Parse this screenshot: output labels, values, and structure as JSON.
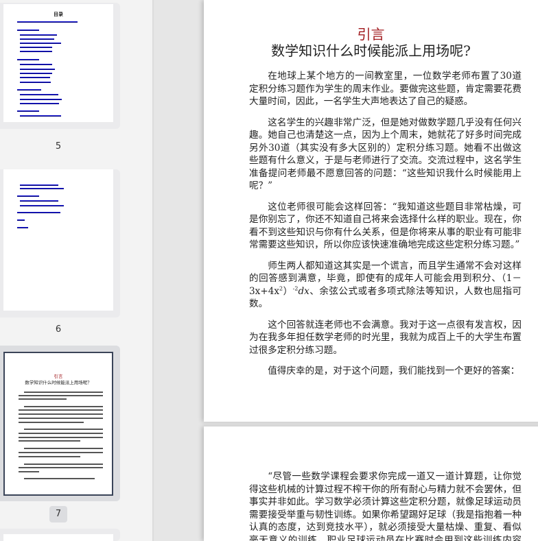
{
  "sidebar": {
    "thumbnails": [
      {
        "page_label": "5",
        "title": "目录"
      },
      {
        "page_label": "6"
      },
      {
        "page_label": "7",
        "title": "引言",
        "subtitle": "数学知识什么时候能派上用场呢？",
        "selected": true
      }
    ]
  },
  "document": {
    "page1": {
      "title": "引言",
      "subtitle": "数学知识什么时候能派上用场呢?",
      "paragraphs": [
        "在地球上某个地方的一间教室里，一位数学老师布置了30道定积分练习题作为学生的周末作业。要做完这些题，肯定需要花费大量时间，因此，一名学生大声地表达了自己的疑惑。",
        "这名学生的兴趣非常广泛，但是她对做数学题几乎没有任何兴趣。她自己也清楚这一点，因为上个周末，她就花了好多时间完成另外30道（其实没有多大区别的）定积分练习题。她看不出做这些题有什么意义，于是与老师进行了交流。交流过程中，这名学生准备提问老师最不愿意回答的问题：“这些知识我什么时候能用上呢？”",
        "这位老师很可能会这样回答：“我知道这些题目非常枯燥，可是你别忘了，你还不知道自己将来会选择什么样的职业。现在，你看不到这些知识与你有什么关系，但是你将来从事的职业有可能非常需要这些知识，所以你应该快速准确地完成这些定积分练习题。”",
        "这个回答就连老师也不会满意。我对于这一点很有发言权，因为在我多年担任数学老师的时光里，我就为成百上千的大学生布置过很多定积分练习题。",
        "值得庆幸的是，对于这个问题，我们能找到一个更好的答案："
      ],
      "para4_before": "师生两人都知道这其实是一个谎言，而且学生通常不会对这样的回答感到满意，毕竟，即使有的成年人可能会用到积分、（1－3x+4x",
      "para4_exp1": "2",
      "para4_mid": "）",
      "para4_exp2": "-2",
      "para4_dx": "dx",
      "para4_after": "、余弦公式或者多项式除法等知识，人数也屈指可数。"
    },
    "page2": {
      "paragraphs": [
        "“尽管一些数学课程会要求你完成一道又一道计算题，让你觉得这些机械的计算过程不榨干你的所有耐心与精力就不会罢休，但事实并非如此。学习数学必须计算这些定积分题，就像足球运动员需要接受举重与韧性训练。如果你希望踢好足球（我是指抱着一种认真的态度，达到竞技水平），就必须接受大量枯燥、重复、看似毫无意义的训练。职业足球运动员在比赛时会用到这些训练内容吗？不会的，我们从未在赛场"
      ]
    }
  }
}
